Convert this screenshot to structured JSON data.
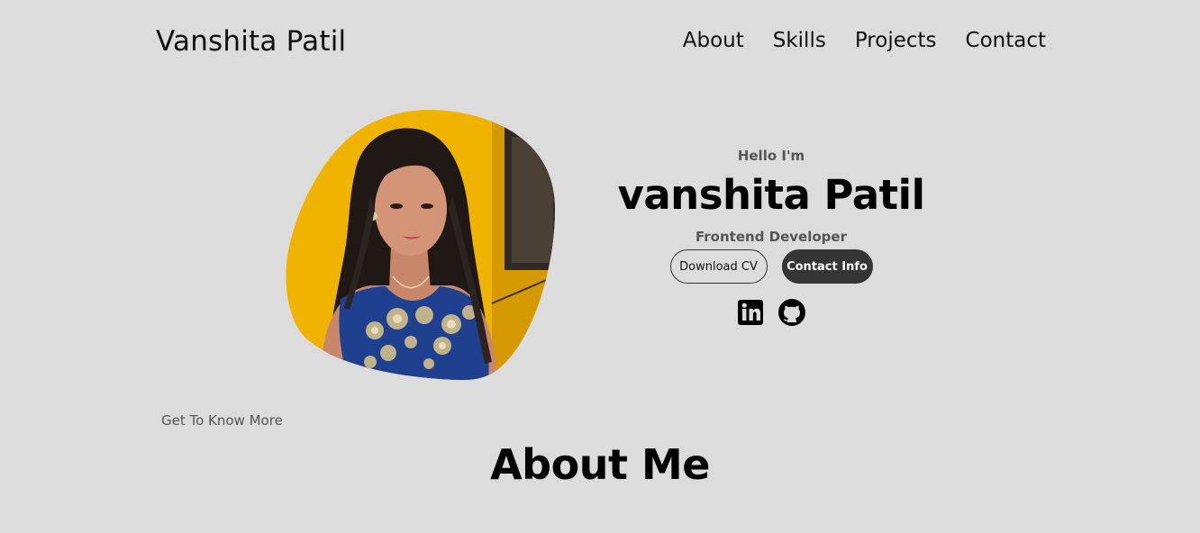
{
  "header": {
    "logo": "Vanshita Patil",
    "nav": [
      {
        "label": "About"
      },
      {
        "label": "Skills"
      },
      {
        "label": "Projects"
      },
      {
        "label": "Contact"
      }
    ]
  },
  "hero": {
    "greeting": "Hello I'm",
    "name": "vanshita Patil",
    "role": "Frontend Developer",
    "buttons": {
      "download_cv": "Download CV",
      "contact_info": "Contact Info"
    },
    "socials": [
      "linkedin-icon",
      "github-icon"
    ]
  },
  "about": {
    "kicker": "Get To Know More",
    "title": "About Me"
  },
  "colors": {
    "background": "#dcdcdc",
    "dark_button": "#353535",
    "photo_backdrop": "#f0b400",
    "dress": "#1f3f8f"
  }
}
